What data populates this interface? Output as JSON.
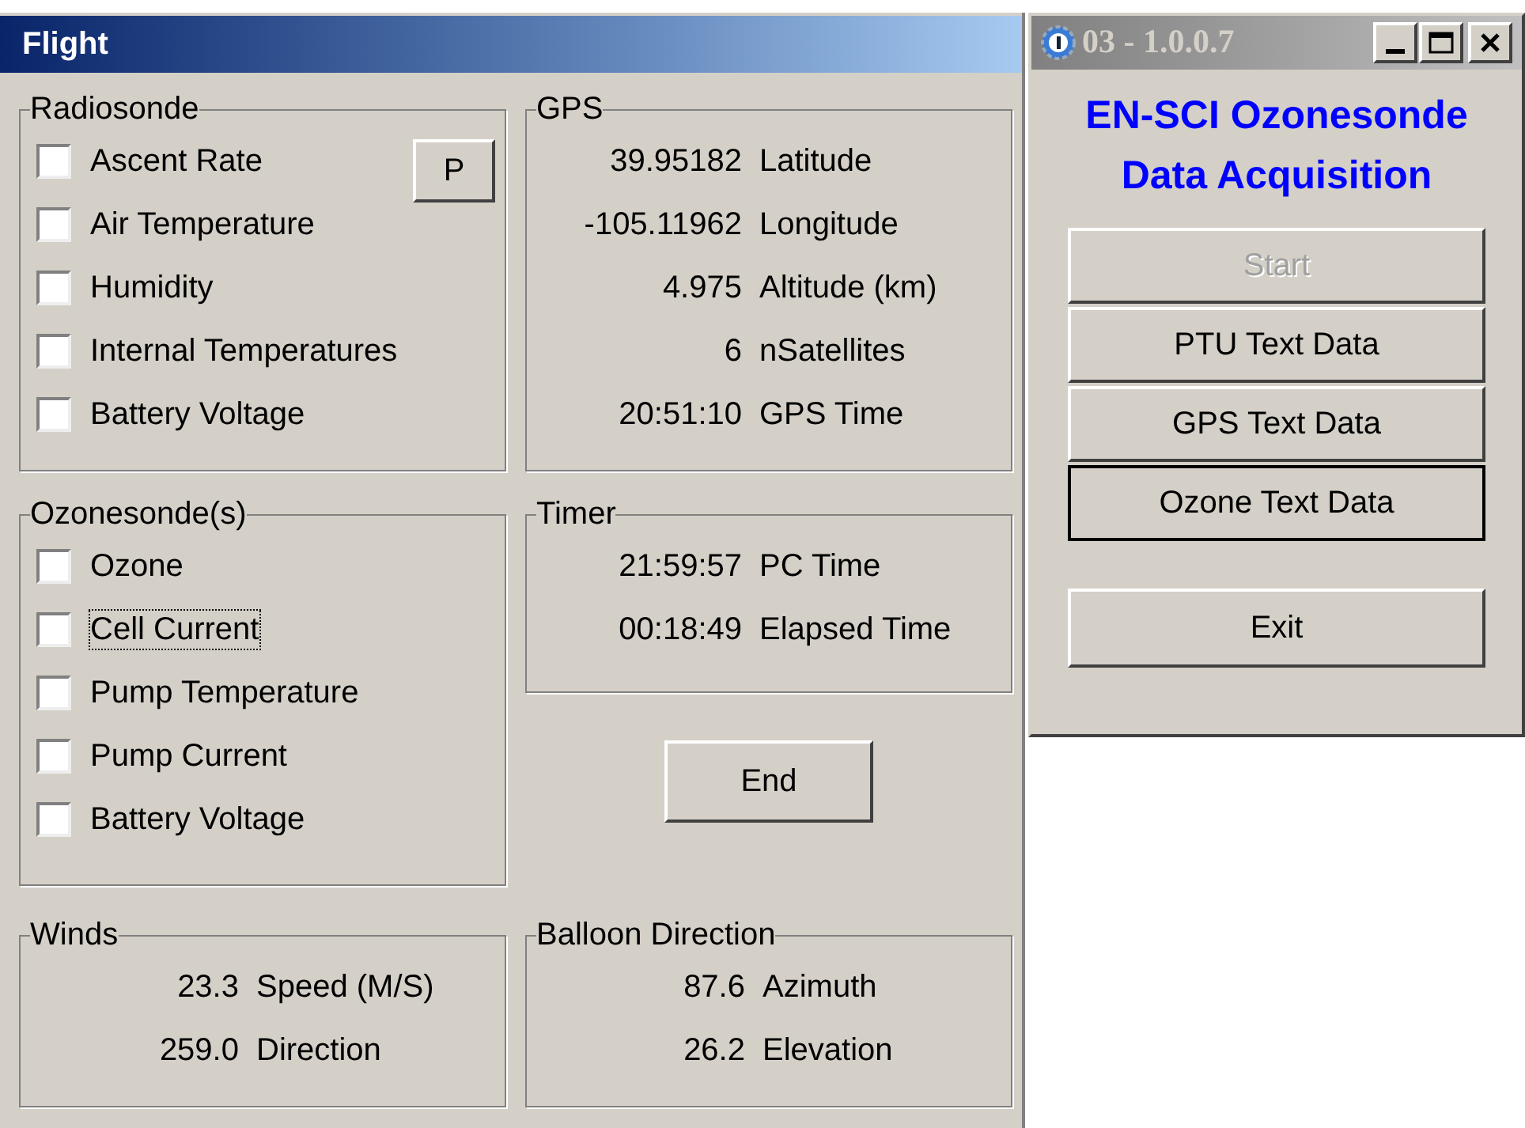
{
  "flight_window": {
    "title": "Flight",
    "radiosonde": {
      "title": "Radiosonde",
      "button": "P",
      "items": [
        {
          "label": "Ascent Rate",
          "checked": false,
          "focused": false
        },
        {
          "label": "Air Temperature",
          "checked": false,
          "focused": false
        },
        {
          "label": "Humidity",
          "checked": false,
          "focused": false
        },
        {
          "label": "Internal Temperatures",
          "checked": false,
          "focused": false
        },
        {
          "label": "Battery Voltage",
          "checked": false,
          "focused": false
        }
      ]
    },
    "gps": {
      "title": "GPS",
      "readings": [
        {
          "value": "39.95182",
          "label": "Latitude"
        },
        {
          "value": "-105.11962",
          "label": "Longitude"
        },
        {
          "value": "4.975",
          "label": "Altitude (km)"
        },
        {
          "value": "6",
          "label": "nSatellites"
        },
        {
          "value": "20:51:10",
          "label": "GPS Time"
        }
      ]
    },
    "ozonesondes": {
      "title": "Ozonesonde(s)",
      "items": [
        {
          "label": "Ozone",
          "checked": false,
          "focused": false
        },
        {
          "label": "Cell Current",
          "checked": false,
          "focused": true
        },
        {
          "label": "Pump Temperature",
          "checked": false,
          "focused": false
        },
        {
          "label": "Pump Current",
          "checked": false,
          "focused": false
        },
        {
          "label": "Battery Voltage",
          "checked": false,
          "focused": false
        }
      ]
    },
    "timer": {
      "title": "Timer",
      "readings": [
        {
          "value": "21:59:57",
          "label": "PC Time"
        },
        {
          "value": "00:18:49",
          "label": "Elapsed Time"
        }
      ]
    },
    "end_button": "End",
    "winds": {
      "title": "Winds",
      "readings": [
        {
          "value": "23.3",
          "label": "Speed (M/S)"
        },
        {
          "value": "259.0",
          "label": "Direction"
        }
      ]
    },
    "balloon_direction": {
      "title": "Balloon Direction",
      "readings": [
        {
          "value": "87.6",
          "label": "Azimuth"
        },
        {
          "value": "26.2",
          "label": "Elevation"
        }
      ]
    }
  },
  "main_window": {
    "title": "03 - 1.0.0.7",
    "heading_lines": [
      "EN-SCI Ozonesonde",
      "Data Acquisition"
    ],
    "buttons": [
      {
        "label": "Start",
        "disabled": true,
        "default": false
      },
      {
        "label": "PTU Text Data",
        "disabled": false,
        "default": false
      },
      {
        "label": "GPS Text Data",
        "disabled": false,
        "default": false
      },
      {
        "label": "Ozone Text Data",
        "disabled": false,
        "default": true
      }
    ],
    "exit_button": "Exit"
  }
}
